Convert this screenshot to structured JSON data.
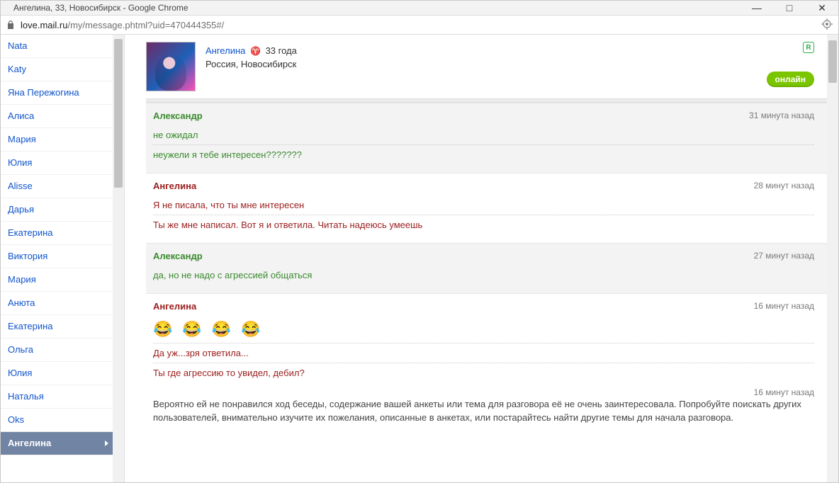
{
  "window": {
    "title": "Ангелина, 33, Новосибирск - Google Chrome",
    "controls": {
      "min": "—",
      "max": "□",
      "close": "✕"
    }
  },
  "addressbar": {
    "host": "love.mail.ru",
    "path": "/my/message.phtml?uid=470444355#/"
  },
  "sidebar": {
    "items": [
      {
        "label": "Nata",
        "active": false
      },
      {
        "label": "Katy",
        "active": false
      },
      {
        "label": "Яна Пережогина",
        "active": false
      },
      {
        "label": "Алиса",
        "active": false
      },
      {
        "label": "Мария",
        "active": false
      },
      {
        "label": "Юлия",
        "active": false
      },
      {
        "label": "Alisse",
        "active": false
      },
      {
        "label": "Дарья",
        "active": false
      },
      {
        "label": "Екатерина",
        "active": false
      },
      {
        "label": "Виктория",
        "active": false
      },
      {
        "label": "Мария",
        "active": false
      },
      {
        "label": "Анюта",
        "active": false
      },
      {
        "label": "Екатерина",
        "active": false
      },
      {
        "label": "Ольга",
        "active": false
      },
      {
        "label": "Юлия",
        "active": false
      },
      {
        "label": "Наталья",
        "active": false
      },
      {
        "label": "Oks",
        "active": false
      },
      {
        "label": "Ангелина",
        "active": true
      }
    ]
  },
  "profile": {
    "name": "Ангелина",
    "age_text": "33 года",
    "location": "Россия, Новосибирск",
    "r_label": "R",
    "status": "онлайн"
  },
  "messages": [
    {
      "side": "other",
      "sender": "Александр",
      "time": "31 минута назад",
      "lines": [
        "не ожидал",
        "неужели я тебе интересен???????"
      ]
    },
    {
      "side": "self",
      "sender": "Ангелина",
      "time": "28 минут назад",
      "lines": [
        "Я не писала, что ты мне интересен",
        "Ты же мне написал. Вот я и ответила. Читать надеюсь умеешь"
      ]
    },
    {
      "side": "other",
      "sender": "Александр",
      "time": "27 минут назад",
      "lines": [
        "да, но не надо с агрессией общаться"
      ]
    },
    {
      "side": "self",
      "sender": "Ангелина",
      "time": "16 минут назад",
      "emoji": "😂😂😂😂",
      "lines": [
        "Да уж...зря ответила...",
        "Ты где агрессию то увидел, дебил?"
      ]
    }
  ],
  "system": {
    "time": "16 минут назад",
    "text": "Вероятно ей не понравился ход беседы, содержание вашей анкеты или тема для разговора её не очень заинтересовала. Попробуйте поискать других пользователей, внимательно изучите их пожелания, описанные в анкетах, или постарайтесь найти другие темы для начала разговора."
  }
}
